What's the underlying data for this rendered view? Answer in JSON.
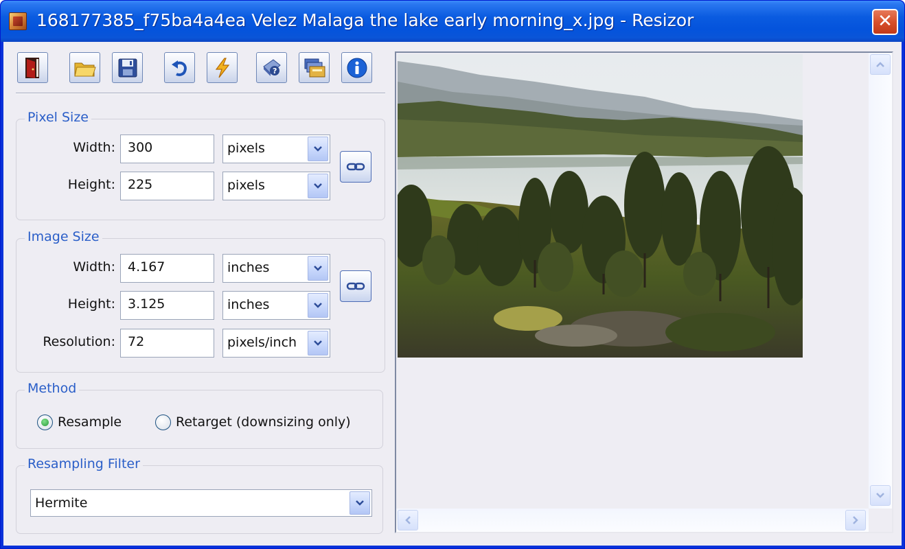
{
  "window": {
    "title": "168177385_f75ba4a4ea Velez Malaga the lake early morning_x.jpg - Resizor"
  },
  "toolbar": {
    "buttons": [
      {
        "name": "exit",
        "icon": "door-exit-icon"
      },
      {
        "name": "open",
        "icon": "folder-open-icon"
      },
      {
        "name": "save",
        "icon": "floppy-save-icon"
      },
      {
        "name": "undo",
        "icon": "undo-arrow-icon"
      },
      {
        "name": "process",
        "icon": "lightning-icon"
      },
      {
        "name": "help",
        "icon": "help-book-icon"
      },
      {
        "name": "batch",
        "icon": "batch-resize-icon"
      },
      {
        "name": "about",
        "icon": "info-icon"
      }
    ]
  },
  "pixel_size": {
    "legend": "Pixel Size",
    "width_label": "Width:",
    "width_value": "300",
    "width_unit": "pixels",
    "height_label": "Height:",
    "height_value": "225",
    "height_unit": "pixels"
  },
  "image_size": {
    "legend": "Image Size",
    "width_label": "Width:",
    "width_value": "4.167",
    "width_unit": "inches",
    "height_label": "Height:",
    "height_value": "3.125",
    "height_unit": "inches",
    "resolution_label": "Resolution:",
    "resolution_value": "72",
    "resolution_unit": "pixels/inch"
  },
  "method": {
    "legend": "Method",
    "options": [
      {
        "label": "Resample",
        "selected": true
      },
      {
        "label": "Retarget (downsizing only)",
        "selected": false
      }
    ]
  },
  "resampling_filter": {
    "legend": "Resampling Filter",
    "selected": "Hermite"
  },
  "colors": {
    "titlebar": "#0a5be0",
    "legend_text": "#2a5ec8",
    "client_bg": "#eeedf3",
    "close_button": "#d8502b"
  }
}
